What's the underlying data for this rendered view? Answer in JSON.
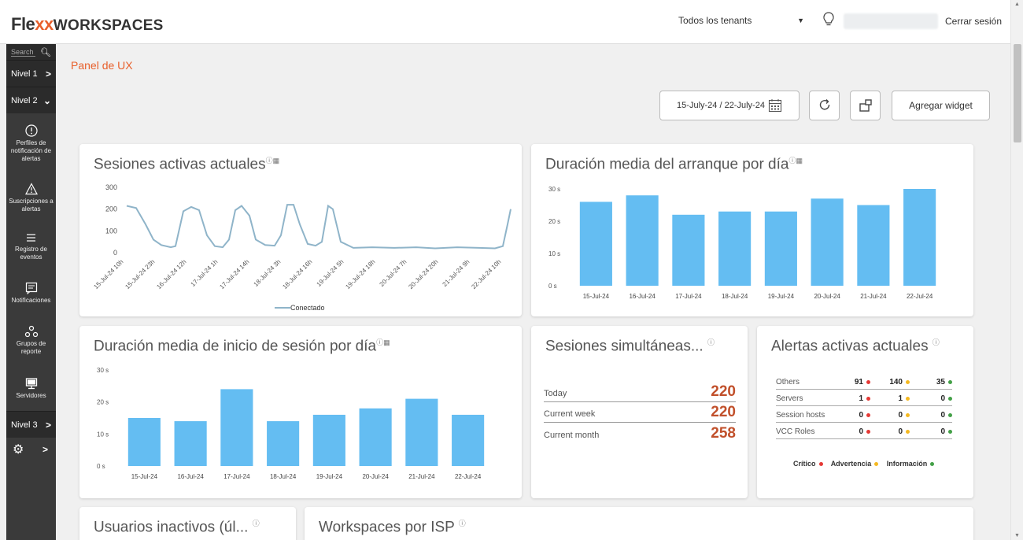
{
  "header": {
    "logo_flex": "Fle",
    "logo_xx": "xx",
    "logo_ws": "WORKSPACES",
    "tenant_select": "Todos los tenants",
    "logout": "Cerrar sesión"
  },
  "sidebar": {
    "search_placeholder": "Search",
    "levels": [
      "Nivel 1",
      "Nivel 2",
      "Nivel 3"
    ],
    "items": [
      {
        "label": "Perfiles de notificación de alertas",
        "icon": "alert-circle-icon"
      },
      {
        "label": "Suscripciones a alertas",
        "icon": "warning-triangle-icon"
      },
      {
        "label": "Registro de eventos",
        "icon": "list-icon"
      },
      {
        "label": "Notificaciones",
        "icon": "message-icon"
      },
      {
        "label": "Grupos de reporte",
        "icon": "group-icon"
      },
      {
        "label": "Servidores",
        "icon": "monitor-icon"
      }
    ]
  },
  "page": {
    "title": "Panel de UX",
    "date_range": "15-July-24 / 22-July-24",
    "add_widget": "Agregar widget"
  },
  "widgets": {
    "sessions_active": {
      "title": "Sesiones activas actuales",
      "info_glyph": "ⓘ",
      "cal_glyph": "▦"
    },
    "boot_duration": {
      "title": "Duración media del arranque por día",
      "info_glyph": "ⓘ",
      "cal_glyph": "▦"
    },
    "login_duration": {
      "title": "Duración media de inicio de sesión por día",
      "info_glyph": "ⓘ",
      "cal_glyph": "▦"
    },
    "concurrent": {
      "title": "Sesiones simultáneas...",
      "info_glyph": "ⓘ",
      "rows": [
        {
          "label": "Today",
          "value": "220"
        },
        {
          "label": "Current week",
          "value": "220"
        },
        {
          "label": "Current month",
          "value": "258"
        }
      ]
    },
    "alerts": {
      "title": "Alertas activas actuales",
      "info_glyph": "ⓘ",
      "rows": [
        {
          "label": "Others",
          "critical": "91",
          "warning": "140",
          "info": "35"
        },
        {
          "label": "Servers",
          "critical": "1",
          "warning": "1",
          "info": "0"
        },
        {
          "label": "Session hosts",
          "critical": "0",
          "warning": "0",
          "info": "0"
        },
        {
          "label": "VCC Roles",
          "critical": "0",
          "warning": "0",
          "info": "0"
        }
      ],
      "legend": {
        "critical": "Crítico",
        "warning": "Advertencia",
        "info": "Información"
      },
      "colors": {
        "critical": "#e53935",
        "warning": "#f5b921",
        "info": "#43a047"
      }
    },
    "inactive_users": {
      "title": "Usuarios inactivos (úl...",
      "info_glyph": "ⓘ"
    },
    "isp": {
      "title": "Workspaces por ISP",
      "info_glyph": "ⓘ"
    }
  },
  "chart_data": [
    {
      "type": "line",
      "title": "Sesiones activas actuales",
      "x": [
        "15-Jul-24 10h",
        "15-Jul-24 23h",
        "16-Jul-24 12h",
        "17-Jul-24 1h",
        "17-Jul-24 14h",
        "18-Jul-24 3h",
        "18-Jul-24 16h",
        "19-Jul-24 5h",
        "19-Jul-24 18h",
        "20-Jul-24 7h",
        "20-Jul-24 20h",
        "21-Jul-24 9h",
        "22-Jul-24 10h"
      ],
      "ylim": [
        0,
        300
      ],
      "yticks": [
        0,
        100,
        200,
        300
      ],
      "series": [
        {
          "name": "Conectado",
          "color": "#8fb4c9",
          "points": [
            [
              0,
              215
            ],
            [
              0.3,
              205
            ],
            [
              0.6,
              130
            ],
            [
              0.85,
              60
            ],
            [
              1.1,
              35
            ],
            [
              1.4,
              25
            ],
            [
              1.55,
              30
            ],
            [
              1.8,
              190
            ],
            [
              2.05,
              210
            ],
            [
              2.3,
              195
            ],
            [
              2.55,
              80
            ],
            [
              2.8,
              30
            ],
            [
              3.05,
              25
            ],
            [
              3.25,
              60
            ],
            [
              3.45,
              195
            ],
            [
              3.65,
              215
            ],
            [
              3.9,
              170
            ],
            [
              4.1,
              60
            ],
            [
              4.4,
              35
            ],
            [
              4.7,
              32
            ],
            [
              4.9,
              80
            ],
            [
              5.1,
              220
            ],
            [
              5.3,
              220
            ],
            [
              5.5,
              130
            ],
            [
              5.75,
              40
            ],
            [
              6.0,
              32
            ],
            [
              6.2,
              50
            ],
            [
              6.4,
              215
            ],
            [
              6.55,
              200
            ],
            [
              6.8,
              50
            ],
            [
              7.2,
              22
            ],
            [
              7.8,
              25
            ],
            [
              8.5,
              22
            ],
            [
              9.2,
              25
            ],
            [
              9.8,
              20
            ],
            [
              10.5,
              25
            ],
            [
              11.2,
              22
            ],
            [
              11.7,
              20
            ],
            [
              11.95,
              30
            ],
            [
              12.1,
              130
            ],
            [
              12.2,
              200
            ]
          ]
        }
      ]
    },
    {
      "type": "bar",
      "title": "Duración media del arranque por día",
      "categories": [
        "15-Jul-24",
        "16-Jul-24",
        "17-Jul-24",
        "18-Jul-24",
        "19-Jul-24",
        "20-Jul-24",
        "21-Jul-24",
        "22-Jul-24"
      ],
      "values": [
        26,
        28,
        22,
        23,
        23,
        27,
        25,
        30
      ],
      "ylim": [
        0,
        30
      ],
      "yticks": [
        "0 s",
        "10 s",
        "20 s",
        "30 s"
      ],
      "color": "#64bdf2"
    },
    {
      "type": "bar",
      "title": "Duración media de inicio de sesión por día",
      "categories": [
        "15-Jul-24",
        "16-Jul-24",
        "17-Jul-24",
        "18-Jul-24",
        "19-Jul-24",
        "20-Jul-24",
        "21-Jul-24",
        "22-Jul-24"
      ],
      "values": [
        15,
        14,
        24,
        14,
        16,
        18,
        21,
        16
      ],
      "ylim": [
        0,
        30
      ],
      "yticks": [
        "0 s",
        "10 s",
        "20 s",
        "30 s"
      ],
      "color": "#64bdf2"
    }
  ]
}
